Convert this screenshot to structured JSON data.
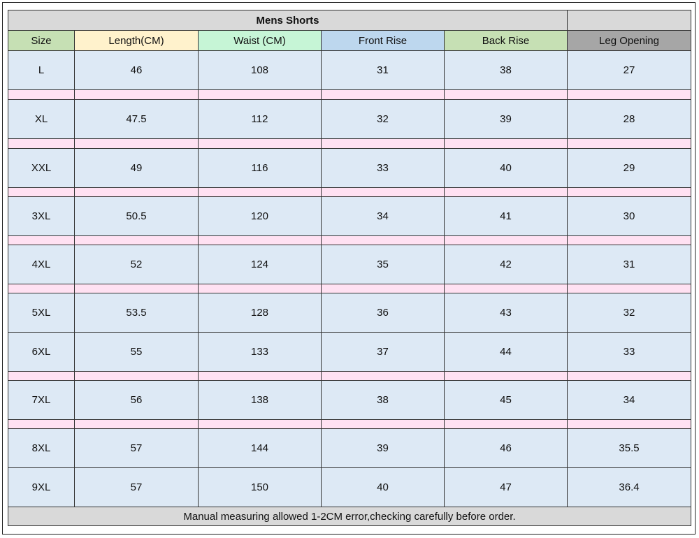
{
  "title": "Mens Shorts",
  "headers": [
    "Size",
    "Length(CM)",
    "Waist (CM)",
    "Front Rise",
    "Back Rise",
    "Leg Opening"
  ],
  "rows": [
    [
      "L",
      "46",
      "108",
      "31",
      "38",
      "27"
    ],
    [
      "XL",
      "47.5",
      "112",
      "32",
      "39",
      "28"
    ],
    [
      "XXL",
      "49",
      "116",
      "33",
      "40",
      "29"
    ],
    [
      "3XL",
      "50.5",
      "120",
      "34",
      "41",
      "30"
    ],
    [
      "4XL",
      "52",
      "124",
      "35",
      "42",
      "31"
    ],
    [
      "5XL",
      "53.5",
      "128",
      "36",
      "43",
      "32"
    ],
    [
      "6XL",
      "55",
      "133",
      "37",
      "44",
      "33"
    ],
    [
      "7XL",
      "56",
      "138",
      "38",
      "45",
      "34"
    ],
    [
      "8XL",
      "57",
      "144",
      "39",
      "46",
      "35.5"
    ],
    [
      "9XL",
      "57",
      "150",
      "40",
      "47",
      "36.4"
    ]
  ],
  "note": "Manual measuring allowed 1-2CM error,checking carefully before order.",
  "colors": {
    "size_header": "#c6e0b4",
    "length_header": "#fff2cc",
    "waist_header": "#c6f5d6",
    "front_rise_header": "#bdd7ee",
    "back_rise_header": "#c6e0b4",
    "leg_opening_header": "#a6a6a6",
    "data_cell": "#dde9f5",
    "separator": "#ffe1f2",
    "title_bg": "#d9d9d9"
  }
}
